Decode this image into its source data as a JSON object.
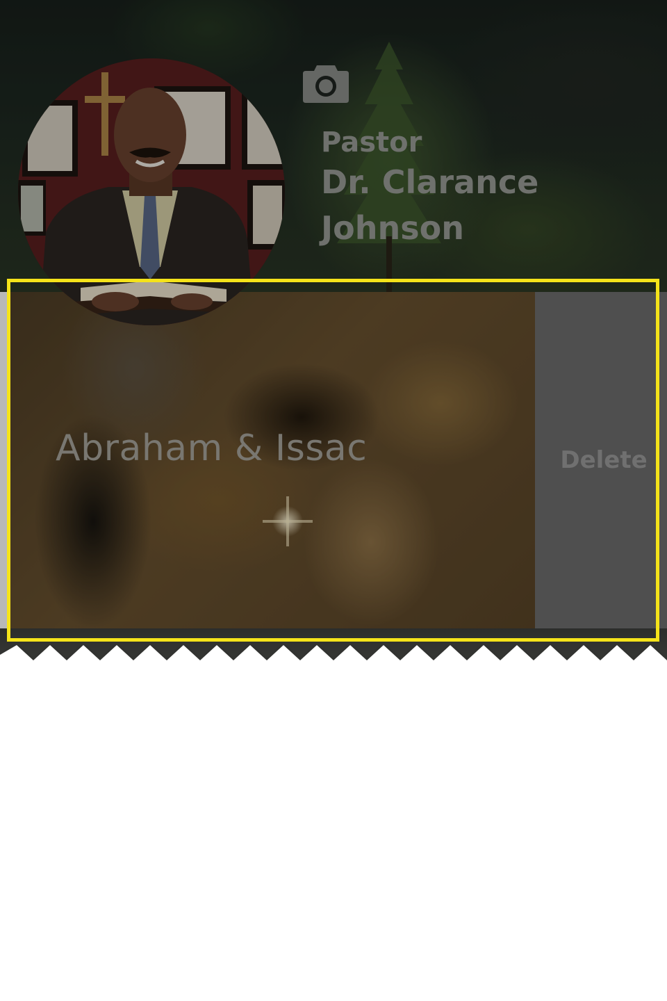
{
  "profile": {
    "title_line1": "Pastor",
    "title_line2": "Dr. Clarance",
    "title_line3": "Johnson",
    "camera_icon": "camera-icon"
  },
  "sermons": [
    {
      "title": "Abraham & Issac",
      "delete_label": "Delete"
    }
  ],
  "colors": {
    "highlight": "#f5e31a",
    "delete_bg": "#6e6e6e",
    "name_text": "#9a9d98"
  }
}
